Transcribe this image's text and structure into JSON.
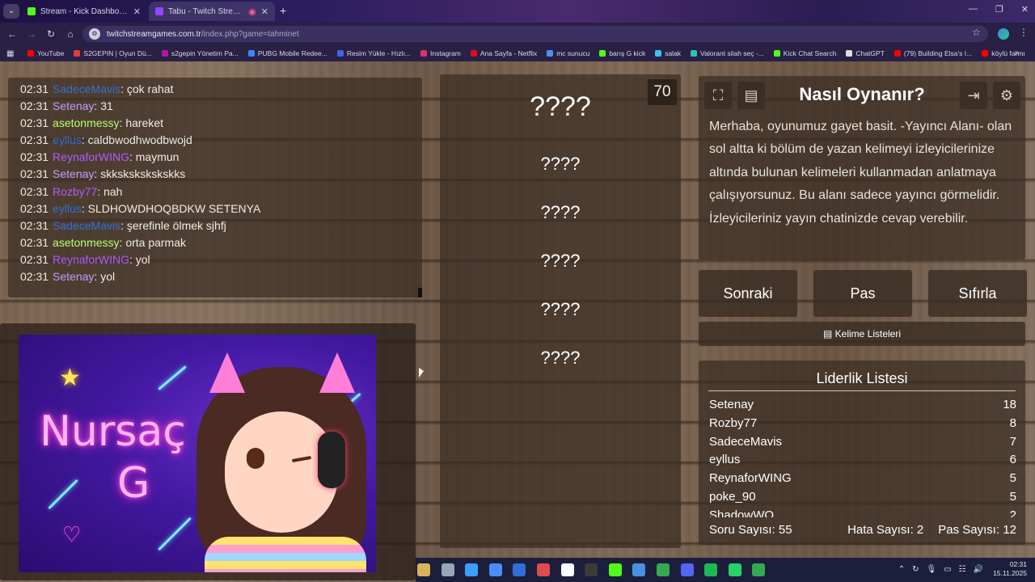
{
  "browser": {
    "tabs": [
      {
        "title": "Stream - Kick Dashboard",
        "active": false,
        "favicon_color": "#53fc18"
      },
      {
        "title": "Tabu - Twitch Stream Game",
        "active": true,
        "favicon_color": "#9146ff"
      }
    ],
    "url_domain": "twitchstreamgames.com.tr",
    "url_path": "/index.php?game=tahminet",
    "bookmarks": [
      {
        "label": "YouTube",
        "color": "#ff0000"
      },
      {
        "label": "S2GEPIN | Oyun Dü...",
        "color": "#e63946"
      },
      {
        "label": "s2gepin Yönetim Pa...",
        "color": "#b5179e"
      },
      {
        "label": "PUBG Mobile Redee...",
        "color": "#3a86ff"
      },
      {
        "label": "Resim Yükle - Hızlı...",
        "color": "#4361ee"
      },
      {
        "label": "Instagram",
        "color": "#e1306c"
      },
      {
        "label": "Ana Sayfa - Netflix",
        "color": "#e50914"
      },
      {
        "label": "mc sunucu",
        "color": "#4895ef"
      },
      {
        "label": "barış G kick",
        "color": "#53fc18"
      },
      {
        "label": "salak",
        "color": "#36c5f0"
      },
      {
        "label": "Valorant silah seç -...",
        "color": "#2ec4b6"
      },
      {
        "label": "Kick Chat Search",
        "color": "#53fc18"
      },
      {
        "label": "ChatGPT",
        "color": "#dddddd"
      },
      {
        "label": "(79) Building Elsa's I...",
        "color": "#ff0000"
      },
      {
        "label": "köylü farmı",
        "color": "#ff0000"
      }
    ]
  },
  "chat": {
    "messages": [
      {
        "time": "02:31",
        "user": "SadeceMavis",
        "color": "#2f6fd6",
        "text": "çok rahat"
      },
      {
        "time": "02:31",
        "user": "Setenay",
        "color": "#c59bff",
        "text": "31"
      },
      {
        "time": "02:31",
        "user": "asetonmessy",
        "color": "#b6ff72",
        "text": "hareket"
      },
      {
        "time": "02:31",
        "user": "eyllus",
        "color": "#2f6fd6",
        "text": "caldbwodhwodbwojd"
      },
      {
        "time": "02:31",
        "user": "ReynaforWING",
        "color": "#b05cff",
        "text": "maymun"
      },
      {
        "time": "02:31",
        "user": "Setenay",
        "color": "#c59bff",
        "text": "skkskskskskskks"
      },
      {
        "time": "02:31",
        "user": "Rozby77",
        "color": "#b05cff",
        "text": "nah"
      },
      {
        "time": "02:31",
        "user": "eyllus",
        "color": "#2f6fd6",
        "text": "SLDHOWDHOQBDKW SETENYA"
      },
      {
        "time": "02:31",
        "user": "SadeceMavis",
        "color": "#2f6fd6",
        "text": "şerefinle ölmek sjhfj"
      },
      {
        "time": "02:31",
        "user": "asetonmessy",
        "color": "#b6ff72",
        "text": "orta parmak"
      },
      {
        "time": "02:31",
        "user": "ReynaforWING",
        "color": "#b05cff",
        "text": "yol"
      },
      {
        "time": "02:31",
        "user": "Setenay",
        "color": "#c59bff",
        "text": "yol"
      }
    ]
  },
  "stream_art": {
    "title_line1": "Nursaç",
    "title_line2": "G"
  },
  "game": {
    "timer": "70",
    "main_word": "????",
    "forbidden_words": [
      "????",
      "????",
      "????",
      "????",
      "????"
    ]
  },
  "info": {
    "title": "Nasıl Oynanır?",
    "text": "Merhaba, oyunumuz gayet basit. -Yayıncı Alanı- olan sol altta ki bölüm de yazan kelimeyi izleyicilerinize altında bulunan kelimeleri kullanmadan anlatmaya çalışıyorsunuz. Bu alanı sadece yayıncı görmelidir. İzleyicileriniz yayın chatinizde cevap verebilir."
  },
  "controls": {
    "next": "Sonraki",
    "pass": "Pas",
    "reset": "Sıfırla",
    "word_lists": "Kelime Listeleri"
  },
  "leaderboard": {
    "title": "Liderlik Listesi",
    "rows": [
      {
        "name": "Setenay",
        "score": "18"
      },
      {
        "name": "Rozby77",
        "score": "8"
      },
      {
        "name": "SadeceMavis",
        "score": "7"
      },
      {
        "name": "eyllus",
        "score": "6"
      },
      {
        "name": "ReynaforWING",
        "score": "5"
      },
      {
        "name": "poke_90",
        "score": "5"
      },
      {
        "name": "ShadowWO",
        "score": "2"
      }
    ],
    "question_count": "Soru Sayısı: 55",
    "error_count": "Hata Sayısı: 2",
    "pass_count": "Pas Sayısı: 12"
  },
  "taskbar": {
    "time": "02:31",
    "date": "15.11.2025",
    "icon_colors": [
      "#d9b35a",
      "#9aa4b8",
      "#3aa0ff",
      "#4a8bff",
      "#2f6fd6",
      "#e14b4b",
      "#ffffff",
      "#3b3b3b",
      "#53fc18",
      "#4a90e2",
      "#34a853",
      "#5865f2",
      "#1db954",
      "#25d366",
      "#34a853"
    ]
  }
}
